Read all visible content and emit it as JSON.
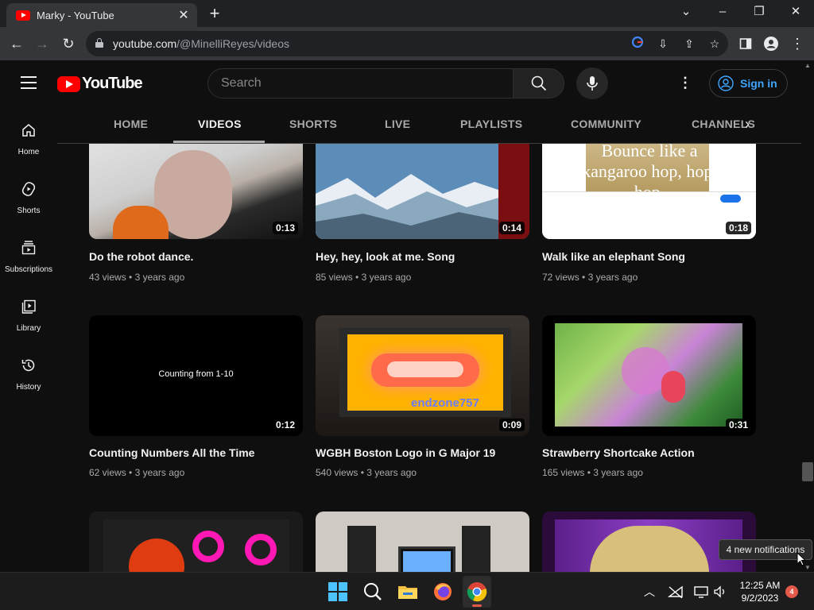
{
  "browser": {
    "tab_title": "Marky - YouTube",
    "url_host": "youtube.com",
    "url_path": "/@MinelliReyes/videos"
  },
  "header": {
    "logo_text": "YouTube",
    "search_placeholder": "Search",
    "sign_in_label": "Sign in"
  },
  "sidebar": {
    "items": [
      {
        "label": "Home",
        "icon": "home-icon"
      },
      {
        "label": "Shorts",
        "icon": "shorts-icon"
      },
      {
        "label": "Subscriptions",
        "icon": "subscriptions-icon"
      },
      {
        "label": "Library",
        "icon": "library-icon"
      },
      {
        "label": "History",
        "icon": "history-icon"
      }
    ]
  },
  "channel_tabs": [
    "HOME",
    "VIDEOS",
    "SHORTS",
    "LIVE",
    "PLAYLISTS",
    "COMMUNITY",
    "CHANNELS"
  ],
  "active_tab": "VIDEOS",
  "videos": [
    {
      "title": "Do the robot dance.",
      "views": "43 views",
      "age": "3 years ago",
      "duration": "0:13"
    },
    {
      "title": "Hey, hey, look at me. Song",
      "views": "85 views",
      "age": "3 years ago",
      "duration": "0:14"
    },
    {
      "title": "Walk like an elephant Song",
      "views": "72 views",
      "age": "3 years ago",
      "duration": "0:18"
    },
    {
      "title": "Counting Numbers All the Time",
      "views": "62 views",
      "age": "3 years ago",
      "duration": "0:12"
    },
    {
      "title": "WGBH Boston Logo in G Major 19",
      "views": "540 views",
      "age": "3 years ago",
      "duration": "0:09"
    },
    {
      "title": "Strawberry Shortcake Action",
      "views": "165 views",
      "age": "3 years ago",
      "duration": "0:31"
    }
  ],
  "thumb_text": {
    "kangaroo": "Bounce like a kangaroo hop, hop, hop.",
    "counting": "Counting from 1-10",
    "endzone": "endzone757"
  },
  "tooltip": "4 new notifications",
  "taskbar": {
    "time": "12:25 AM",
    "date": "9/2/2023",
    "notification_count": "4"
  },
  "colors": {
    "youtube_red": "#ff0000",
    "link_blue": "#3ea6ff",
    "background": "#0f0f0f"
  }
}
